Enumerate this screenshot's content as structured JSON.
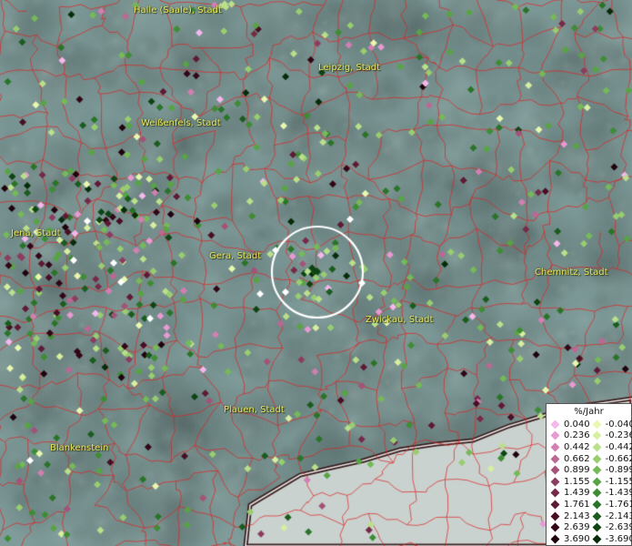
{
  "map": {
    "cities": [
      {
        "id": "halle",
        "name": "Halle (Saale), Stadt"
      },
      {
        "id": "leipzig",
        "name": "Leipzig, Stadt"
      },
      {
        "id": "weissenfels",
        "name": "Weißenfels, Stadt"
      },
      {
        "id": "jena",
        "name": "Jena, Stadt"
      },
      {
        "id": "gera",
        "name": "Gera, Stadt"
      },
      {
        "id": "chemnitz",
        "name": "Chemnitz, Stadt"
      },
      {
        "id": "zwickau",
        "name": "Zwickau, Stadt"
      },
      {
        "id": "plauen",
        "name": "Plauen, Stadt"
      },
      {
        "id": "blankenstein",
        "name": "Blankenstein"
      }
    ],
    "colors": {
      "background": "#7f9c9a",
      "boundaries": "#e02020",
      "label_text": "#e8e25a",
      "highlight_circle": "#ffffff"
    }
  },
  "legend": {
    "title": "%/Jahr",
    "rows": [
      {
        "pos": "0.040",
        "neg": "-0.040",
        "pos_color": "#f4b8ec",
        "neg_color": "#e8f8b0"
      },
      {
        "pos": "0.236",
        "neg": "-0.236",
        "pos_color": "#e89ad2",
        "neg_color": "#d6efa0"
      },
      {
        "pos": "0.442",
        "neg": "-0.442",
        "pos_color": "#d27fb2",
        "neg_color": "#b9e08a"
      },
      {
        "pos": "0.662",
        "neg": "-0.662",
        "pos_color": "#bc6893",
        "neg_color": "#98ce70"
      },
      {
        "pos": "0.899",
        "neg": "-0.899",
        "pos_color": "#a45278",
        "neg_color": "#76ba58"
      },
      {
        "pos": "1.155",
        "neg": "-1.155",
        "pos_color": "#8c3c5e",
        "neg_color": "#58a444"
      },
      {
        "pos": "1.439",
        "neg": "-1.439",
        "pos_color": "#762a48",
        "neg_color": "#3e8c34"
      },
      {
        "pos": "1.761",
        "neg": "-1.761",
        "pos_color": "#5e1a34",
        "neg_color": "#2a7428"
      },
      {
        "pos": "2.143",
        "neg": "-2.143",
        "pos_color": "#480e24",
        "neg_color": "#1a5c1e"
      },
      {
        "pos": "2.639",
        "neg": "-2.639",
        "pos_color": "#320616",
        "neg_color": "#0e4414"
      },
      {
        "pos": "3.690",
        "neg": "-3.690",
        "pos_color": "#1e020c",
        "neg_color": "#062c0a"
      }
    ]
  }
}
